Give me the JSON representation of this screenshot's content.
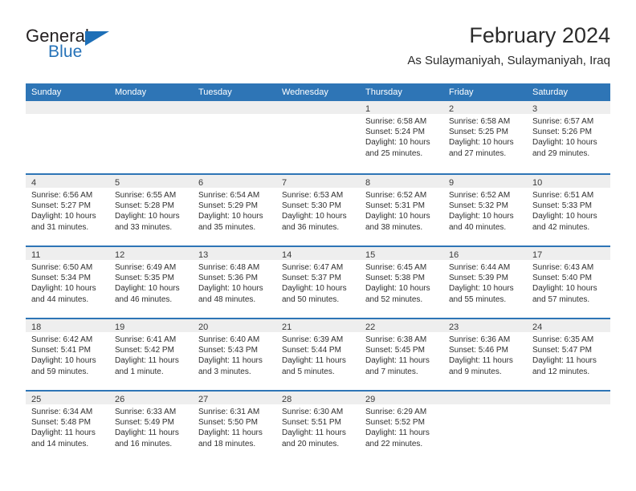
{
  "brand": {
    "word_one": "General",
    "word_two": "Blue",
    "flag_icon": "triangle-flag-icon"
  },
  "header": {
    "title": "February 2024",
    "subtitle": "As Sulaymaniyah, Sulaymaniyah, Iraq"
  },
  "colors": {
    "header_blue": "#2e75b6",
    "brand_blue": "#2572b8",
    "daynum_band": "#eeeeee",
    "text": "#2f2f2f"
  },
  "weekdays": [
    "Sunday",
    "Monday",
    "Tuesday",
    "Wednesday",
    "Thursday",
    "Friday",
    "Saturday"
  ],
  "weeks": [
    [
      {
        "day": "",
        "empty": true
      },
      {
        "day": "",
        "empty": true
      },
      {
        "day": "",
        "empty": true
      },
      {
        "day": "",
        "empty": true
      },
      {
        "day": "1",
        "sunrise": "Sunrise: 6:58 AM",
        "sunset": "Sunset: 5:24 PM",
        "daylight_1": "Daylight: 10 hours",
        "daylight_2": "and 25 minutes."
      },
      {
        "day": "2",
        "sunrise": "Sunrise: 6:58 AM",
        "sunset": "Sunset: 5:25 PM",
        "daylight_1": "Daylight: 10 hours",
        "daylight_2": "and 27 minutes."
      },
      {
        "day": "3",
        "sunrise": "Sunrise: 6:57 AM",
        "sunset": "Sunset: 5:26 PM",
        "daylight_1": "Daylight: 10 hours",
        "daylight_2": "and 29 minutes."
      }
    ],
    [
      {
        "day": "4",
        "sunrise": "Sunrise: 6:56 AM",
        "sunset": "Sunset: 5:27 PM",
        "daylight_1": "Daylight: 10 hours",
        "daylight_2": "and 31 minutes."
      },
      {
        "day": "5",
        "sunrise": "Sunrise: 6:55 AM",
        "sunset": "Sunset: 5:28 PM",
        "daylight_1": "Daylight: 10 hours",
        "daylight_2": "and 33 minutes."
      },
      {
        "day": "6",
        "sunrise": "Sunrise: 6:54 AM",
        "sunset": "Sunset: 5:29 PM",
        "daylight_1": "Daylight: 10 hours",
        "daylight_2": "and 35 minutes."
      },
      {
        "day": "7",
        "sunrise": "Sunrise: 6:53 AM",
        "sunset": "Sunset: 5:30 PM",
        "daylight_1": "Daylight: 10 hours",
        "daylight_2": "and 36 minutes."
      },
      {
        "day": "8",
        "sunrise": "Sunrise: 6:52 AM",
        "sunset": "Sunset: 5:31 PM",
        "daylight_1": "Daylight: 10 hours",
        "daylight_2": "and 38 minutes."
      },
      {
        "day": "9",
        "sunrise": "Sunrise: 6:52 AM",
        "sunset": "Sunset: 5:32 PM",
        "daylight_1": "Daylight: 10 hours",
        "daylight_2": "and 40 minutes."
      },
      {
        "day": "10",
        "sunrise": "Sunrise: 6:51 AM",
        "sunset": "Sunset: 5:33 PM",
        "daylight_1": "Daylight: 10 hours",
        "daylight_2": "and 42 minutes."
      }
    ],
    [
      {
        "day": "11",
        "sunrise": "Sunrise: 6:50 AM",
        "sunset": "Sunset: 5:34 PM",
        "daylight_1": "Daylight: 10 hours",
        "daylight_2": "and 44 minutes."
      },
      {
        "day": "12",
        "sunrise": "Sunrise: 6:49 AM",
        "sunset": "Sunset: 5:35 PM",
        "daylight_1": "Daylight: 10 hours",
        "daylight_2": "and 46 minutes."
      },
      {
        "day": "13",
        "sunrise": "Sunrise: 6:48 AM",
        "sunset": "Sunset: 5:36 PM",
        "daylight_1": "Daylight: 10 hours",
        "daylight_2": "and 48 minutes."
      },
      {
        "day": "14",
        "sunrise": "Sunrise: 6:47 AM",
        "sunset": "Sunset: 5:37 PM",
        "daylight_1": "Daylight: 10 hours",
        "daylight_2": "and 50 minutes."
      },
      {
        "day": "15",
        "sunrise": "Sunrise: 6:45 AM",
        "sunset": "Sunset: 5:38 PM",
        "daylight_1": "Daylight: 10 hours",
        "daylight_2": "and 52 minutes."
      },
      {
        "day": "16",
        "sunrise": "Sunrise: 6:44 AM",
        "sunset": "Sunset: 5:39 PM",
        "daylight_1": "Daylight: 10 hours",
        "daylight_2": "and 55 minutes."
      },
      {
        "day": "17",
        "sunrise": "Sunrise: 6:43 AM",
        "sunset": "Sunset: 5:40 PM",
        "daylight_1": "Daylight: 10 hours",
        "daylight_2": "and 57 minutes."
      }
    ],
    [
      {
        "day": "18",
        "sunrise": "Sunrise: 6:42 AM",
        "sunset": "Sunset: 5:41 PM",
        "daylight_1": "Daylight: 10 hours",
        "daylight_2": "and 59 minutes."
      },
      {
        "day": "19",
        "sunrise": "Sunrise: 6:41 AM",
        "sunset": "Sunset: 5:42 PM",
        "daylight_1": "Daylight: 11 hours",
        "daylight_2": "and 1 minute."
      },
      {
        "day": "20",
        "sunrise": "Sunrise: 6:40 AM",
        "sunset": "Sunset: 5:43 PM",
        "daylight_1": "Daylight: 11 hours",
        "daylight_2": "and 3 minutes."
      },
      {
        "day": "21",
        "sunrise": "Sunrise: 6:39 AM",
        "sunset": "Sunset: 5:44 PM",
        "daylight_1": "Daylight: 11 hours",
        "daylight_2": "and 5 minutes."
      },
      {
        "day": "22",
        "sunrise": "Sunrise: 6:38 AM",
        "sunset": "Sunset: 5:45 PM",
        "daylight_1": "Daylight: 11 hours",
        "daylight_2": "and 7 minutes."
      },
      {
        "day": "23",
        "sunrise": "Sunrise: 6:36 AM",
        "sunset": "Sunset: 5:46 PM",
        "daylight_1": "Daylight: 11 hours",
        "daylight_2": "and 9 minutes."
      },
      {
        "day": "24",
        "sunrise": "Sunrise: 6:35 AM",
        "sunset": "Sunset: 5:47 PM",
        "daylight_1": "Daylight: 11 hours",
        "daylight_2": "and 12 minutes."
      }
    ],
    [
      {
        "day": "25",
        "sunrise": "Sunrise: 6:34 AM",
        "sunset": "Sunset: 5:48 PM",
        "daylight_1": "Daylight: 11 hours",
        "daylight_2": "and 14 minutes."
      },
      {
        "day": "26",
        "sunrise": "Sunrise: 6:33 AM",
        "sunset": "Sunset: 5:49 PM",
        "daylight_1": "Daylight: 11 hours",
        "daylight_2": "and 16 minutes."
      },
      {
        "day": "27",
        "sunrise": "Sunrise: 6:31 AM",
        "sunset": "Sunset: 5:50 PM",
        "daylight_1": "Daylight: 11 hours",
        "daylight_2": "and 18 minutes."
      },
      {
        "day": "28",
        "sunrise": "Sunrise: 6:30 AM",
        "sunset": "Sunset: 5:51 PM",
        "daylight_1": "Daylight: 11 hours",
        "daylight_2": "and 20 minutes."
      },
      {
        "day": "29",
        "sunrise": "Sunrise: 6:29 AM",
        "sunset": "Sunset: 5:52 PM",
        "daylight_1": "Daylight: 11 hours",
        "daylight_2": "and 22 minutes."
      },
      {
        "day": "",
        "empty": true
      },
      {
        "day": "",
        "empty": true
      }
    ]
  ]
}
